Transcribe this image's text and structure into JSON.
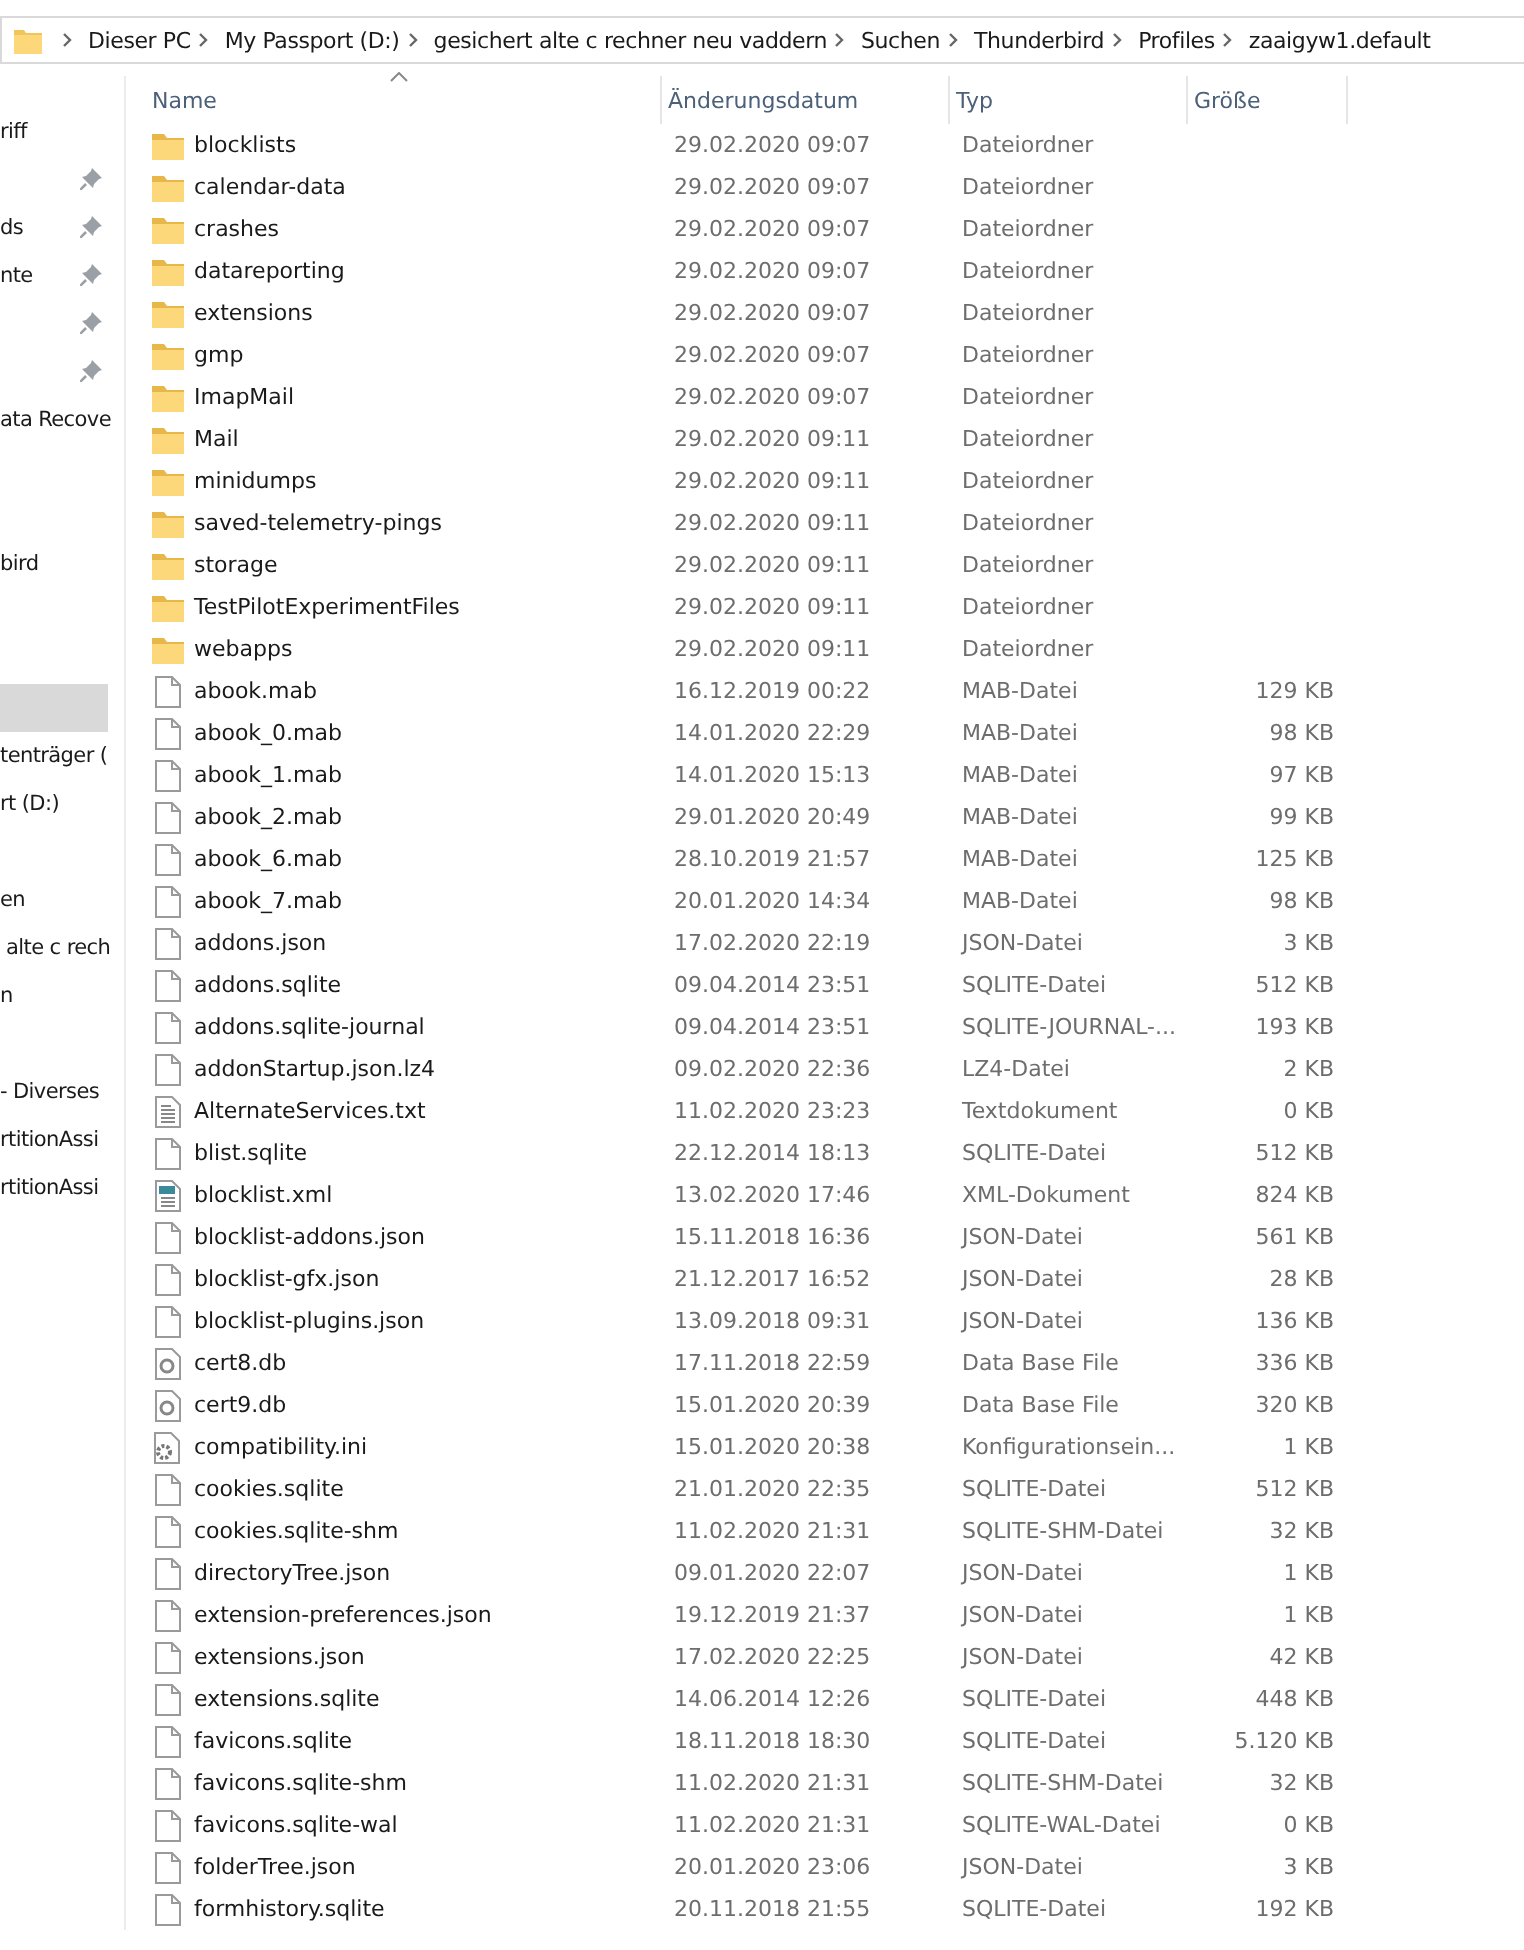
{
  "breadcrumb": [
    "Dieser PC",
    "My Passport (D:)",
    "gesichert alte c rechner neu vaddern",
    "Suchen",
    "Thunderbird",
    "Profiles",
    "zaaigyw1.default"
  ],
  "sidebar": {
    "items": [
      {
        "kind": "entry",
        "label": "riff",
        "pinned": false,
        "selected": false
      },
      {
        "kind": "entry",
        "pinned": true,
        "selected": false
      },
      {
        "kind": "entry",
        "label": "ds",
        "pinned": true,
        "selected": false
      },
      {
        "kind": "entry",
        "label": "nte",
        "pinned": true,
        "selected": false
      },
      {
        "kind": "entry",
        "pinned": true,
        "selected": false
      },
      {
        "kind": "entry",
        "pinned": true,
        "selected": false
      },
      {
        "kind": "entry",
        "label": "ata Recove",
        "pinned": false,
        "selected": false
      },
      {
        "kind": "gap"
      },
      {
        "kind": "gap"
      },
      {
        "kind": "entry",
        "label": "bird",
        "pinned": false,
        "selected": false
      },
      {
        "kind": "gap"
      },
      {
        "kind": "gap"
      },
      {
        "kind": "entry",
        "pinned": false,
        "selected": true
      },
      {
        "kind": "entry",
        "label": "tenträger (",
        "pinned": false,
        "selected": false
      },
      {
        "kind": "entry",
        "label": "rt (D:)",
        "pinned": false,
        "selected": false
      },
      {
        "kind": "gap"
      },
      {
        "kind": "entry",
        "label": "en",
        "pinned": false,
        "selected": false
      },
      {
        "kind": "entry",
        "label": " alte c rech",
        "pinned": false,
        "selected": false
      },
      {
        "kind": "entry",
        "label": "n",
        "pinned": false,
        "selected": false
      },
      {
        "kind": "gap"
      },
      {
        "kind": "entry",
        "label": "- Diverses",
        "pinned": false,
        "selected": false
      },
      {
        "kind": "entry",
        "label": "rtitionAssi",
        "pinned": false,
        "selected": false
      },
      {
        "kind": "entry",
        "label": "rtitionAssi",
        "pinned": false,
        "selected": false
      }
    ]
  },
  "table": {
    "columns": [
      {
        "label": "Name",
        "sorted": true
      },
      {
        "label": "Änderungsdatum",
        "sorted": false
      },
      {
        "label": "Typ",
        "sorted": false
      },
      {
        "label": "Größe",
        "sorted": false
      }
    ],
    "rows": [
      {
        "kind": "folder",
        "name": "blocklists",
        "date": "29.02.2020 09:07",
        "type": "Dateiordner"
      },
      {
        "kind": "folder",
        "name": "calendar-data",
        "date": "29.02.2020 09:07",
        "type": "Dateiordner"
      },
      {
        "kind": "folder",
        "name": "crashes",
        "date": "29.02.2020 09:07",
        "type": "Dateiordner"
      },
      {
        "kind": "folder",
        "name": "datareporting",
        "date": "29.02.2020 09:07",
        "type": "Dateiordner"
      },
      {
        "kind": "folder",
        "name": "extensions",
        "date": "29.02.2020 09:07",
        "type": "Dateiordner"
      },
      {
        "kind": "folder",
        "name": "gmp",
        "date": "29.02.2020 09:07",
        "type": "Dateiordner"
      },
      {
        "kind": "folder",
        "name": "ImapMail",
        "date": "29.02.2020 09:07",
        "type": "Dateiordner"
      },
      {
        "kind": "folder",
        "name": "Mail",
        "date": "29.02.2020 09:11",
        "type": "Dateiordner"
      },
      {
        "kind": "folder",
        "name": "minidumps",
        "date": "29.02.2020 09:11",
        "type": "Dateiordner"
      },
      {
        "kind": "folder",
        "name": "saved-telemetry-pings",
        "date": "29.02.2020 09:11",
        "type": "Dateiordner"
      },
      {
        "kind": "folder",
        "name": "storage",
        "date": "29.02.2020 09:11",
        "type": "Dateiordner"
      },
      {
        "kind": "folder",
        "name": "TestPilotExperimentFiles",
        "date": "29.02.2020 09:11",
        "type": "Dateiordner"
      },
      {
        "kind": "folder",
        "name": "webapps",
        "date": "29.02.2020 09:11",
        "type": "Dateiordner"
      },
      {
        "kind": "file",
        "name": "abook.mab",
        "date": "16.12.2019 00:22",
        "type": "MAB-Datei",
        "size": "129 KB"
      },
      {
        "kind": "file",
        "name": "abook_0.mab",
        "date": "14.01.2020 22:29",
        "type": "MAB-Datei",
        "size": "98 KB"
      },
      {
        "kind": "file",
        "name": "abook_1.mab",
        "date": "14.01.2020 15:13",
        "type": "MAB-Datei",
        "size": "97 KB"
      },
      {
        "kind": "file",
        "name": "abook_2.mab",
        "date": "29.01.2020 20:49",
        "type": "MAB-Datei",
        "size": "99 KB"
      },
      {
        "kind": "file",
        "name": "abook_6.mab",
        "date": "28.10.2019 21:57",
        "type": "MAB-Datei",
        "size": "125 KB"
      },
      {
        "kind": "file",
        "name": "abook_7.mab",
        "date": "20.01.2020 14:34",
        "type": "MAB-Datei",
        "size": "98 KB"
      },
      {
        "kind": "file",
        "name": "addons.json",
        "date": "17.02.2020 22:19",
        "type": "JSON-Datei",
        "size": "3 KB"
      },
      {
        "kind": "file",
        "name": "addons.sqlite",
        "date": "09.04.2014 23:51",
        "type": "SQLITE-Datei",
        "size": "512 KB"
      },
      {
        "kind": "file",
        "name": "addons.sqlite-journal",
        "date": "09.04.2014 23:51",
        "type": "SQLITE-JOURNAL-...",
        "size": "193 KB"
      },
      {
        "kind": "file",
        "name": "addonStartup.json.lz4",
        "date": "09.02.2020 22:36",
        "type": "LZ4-Datei",
        "size": "2 KB"
      },
      {
        "kind": "text",
        "name": "AlternateServices.txt",
        "date": "11.02.2020 23:23",
        "type": "Textdokument",
        "size": "0 KB"
      },
      {
        "kind": "file",
        "name": "blist.sqlite",
        "date": "22.12.2014 18:13",
        "type": "SQLITE-Datei",
        "size": "512 KB"
      },
      {
        "kind": "xml",
        "name": "blocklist.xml",
        "date": "13.02.2020 17:46",
        "type": "XML-Dokument",
        "size": "824 KB"
      },
      {
        "kind": "file",
        "name": "blocklist-addons.json",
        "date": "15.11.2018 16:36",
        "type": "JSON-Datei",
        "size": "561 KB"
      },
      {
        "kind": "file",
        "name": "blocklist-gfx.json",
        "date": "21.12.2017 16:52",
        "type": "JSON-Datei",
        "size": "28 KB"
      },
      {
        "kind": "file",
        "name": "blocklist-plugins.json",
        "date": "13.09.2018 09:31",
        "type": "JSON-Datei",
        "size": "136 KB"
      },
      {
        "kind": "db",
        "name": "cert8.db",
        "date": "17.11.2018 22:59",
        "type": "Data Base File",
        "size": "336 KB"
      },
      {
        "kind": "db",
        "name": "cert9.db",
        "date": "15.01.2020 20:39",
        "type": "Data Base File",
        "size": "320 KB"
      },
      {
        "kind": "ini",
        "name": "compatibility.ini",
        "date": "15.01.2020 20:38",
        "type": "Konfigurationsein...",
        "size": "1 KB"
      },
      {
        "kind": "file",
        "name": "cookies.sqlite",
        "date": "21.01.2020 22:35",
        "type": "SQLITE-Datei",
        "size": "512 KB"
      },
      {
        "kind": "file",
        "name": "cookies.sqlite-shm",
        "date": "11.02.2020 21:31",
        "type": "SQLITE-SHM-Datei",
        "size": "32 KB"
      },
      {
        "kind": "file",
        "name": "directoryTree.json",
        "date": "09.01.2020 22:07",
        "type": "JSON-Datei",
        "size": "1 KB"
      },
      {
        "kind": "file",
        "name": "extension-preferences.json",
        "date": "19.12.2019 21:37",
        "type": "JSON-Datei",
        "size": "1 KB"
      },
      {
        "kind": "file",
        "name": "extensions.json",
        "date": "17.02.2020 22:25",
        "type": "JSON-Datei",
        "size": "42 KB"
      },
      {
        "kind": "file",
        "name": "extensions.sqlite",
        "date": "14.06.2014 12:26",
        "type": "SQLITE-Datei",
        "size": "448 KB"
      },
      {
        "kind": "file",
        "name": "favicons.sqlite",
        "date": "18.11.2018 18:30",
        "type": "SQLITE-Datei",
        "size": "5.120 KB"
      },
      {
        "kind": "file",
        "name": "favicons.sqlite-shm",
        "date": "11.02.2020 21:31",
        "type": "SQLITE-SHM-Datei",
        "size": "32 KB"
      },
      {
        "kind": "file",
        "name": "favicons.sqlite-wal",
        "date": "11.02.2020 21:31",
        "type": "SQLITE-WAL-Datei",
        "size": "0 KB"
      },
      {
        "kind": "file",
        "name": "folderTree.json",
        "date": "20.01.2020 23:06",
        "type": "JSON-Datei",
        "size": "3 KB"
      },
      {
        "kind": "file",
        "name": "formhistory.sqlite",
        "date": "20.11.2018 21:55",
        "type": "SQLITE-Datei",
        "size": "192 KB"
      }
    ]
  }
}
